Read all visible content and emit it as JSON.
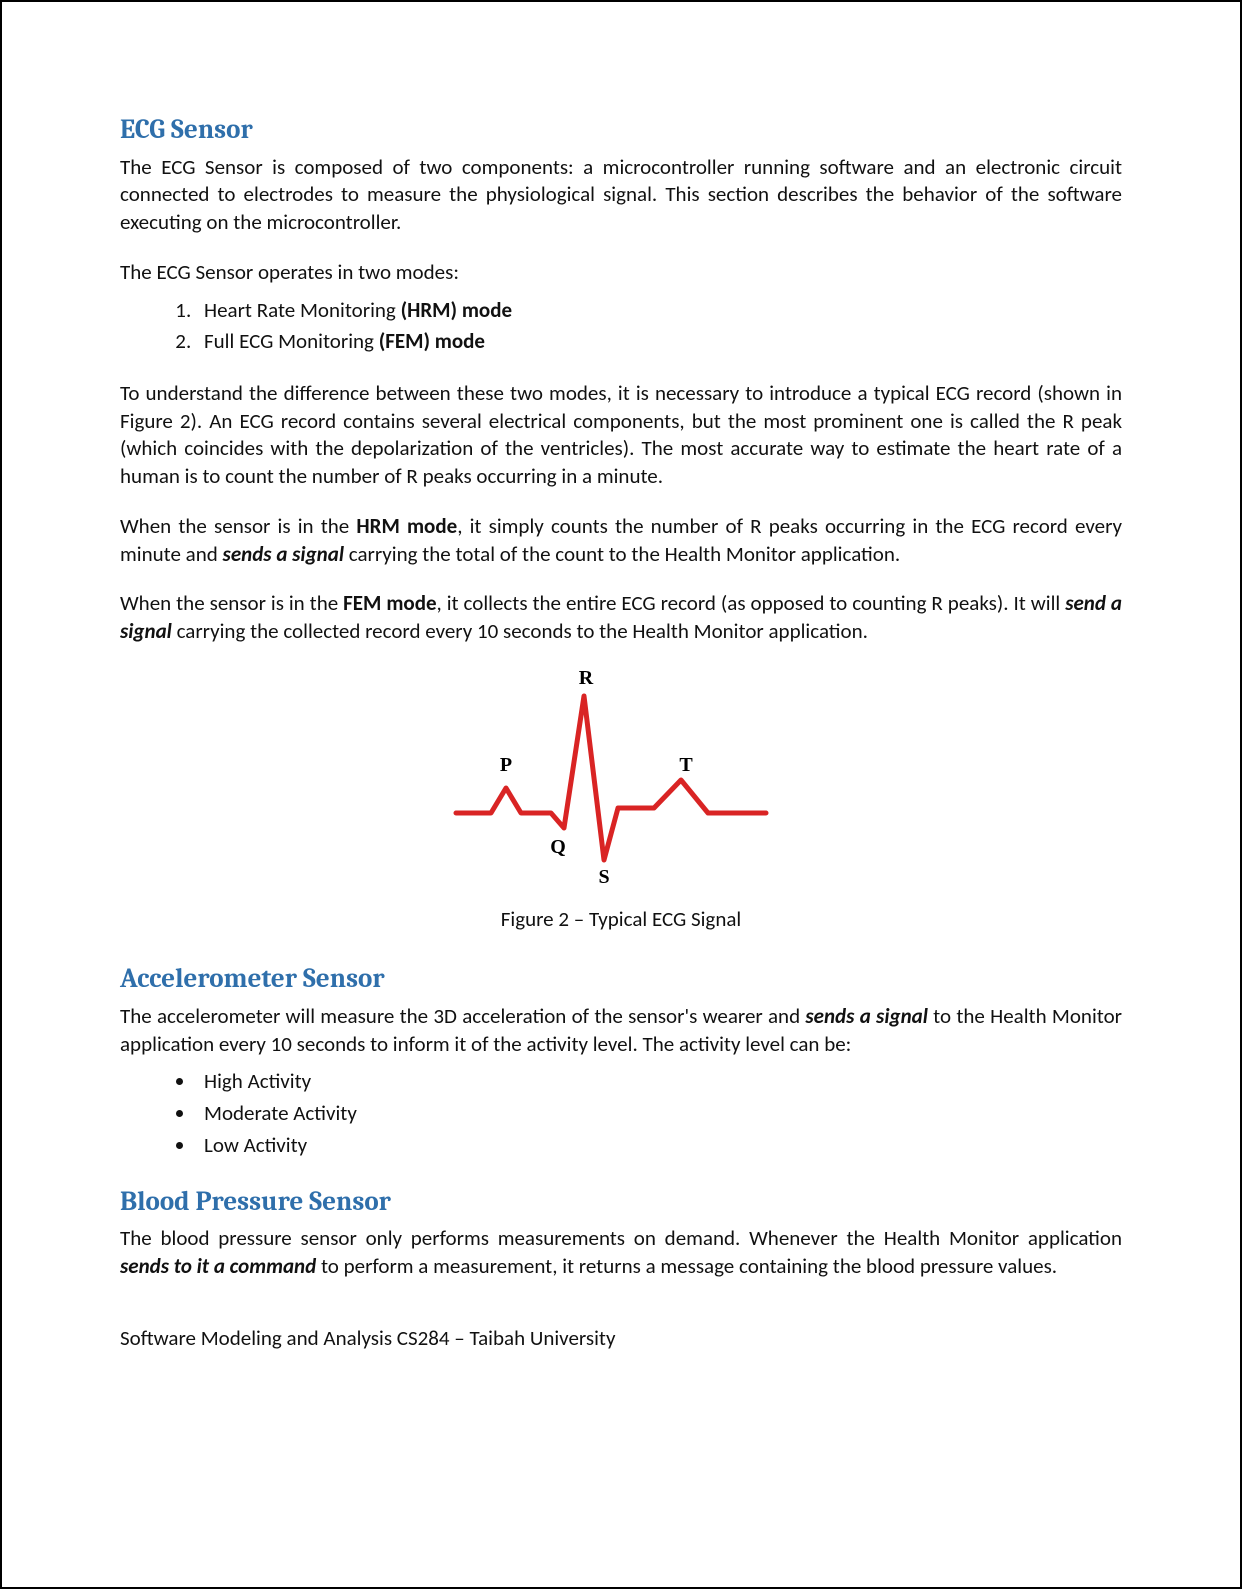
{
  "sections": {
    "ecg": {
      "title": "ECG Sensor",
      "p1": "The ECG Sensor is composed of two components: a microcontroller running software and an electronic circuit connected to electrodes to measure the physiological signal. This section describes the behavior of the software executing on the microcontroller.",
      "p2": "The ECG Sensor operates in two modes:",
      "modes": {
        "m1_pre": "Heart Rate Monitoring ",
        "m1_bold": "(HRM) mode",
        "m2_pre": "Full ECG Monitoring ",
        "m2_bold": "(FEM) mode"
      },
      "p3": "To understand the difference between these two modes, it is necessary to introduce a typical ECG record (shown in Figure 2). An ECG record contains several electrical components, but the most prominent one is called the R peak (which coincides with the depolarization of the ventricles). The most accurate way to estimate the heart rate of a human is to count the number of R peaks occurring in a minute.",
      "p4": {
        "a": "When the sensor is in the ",
        "b": "HRM mode",
        "c": ", it simply counts the number of R peaks occurring in the ECG record every minute and ",
        "d": "sends a signal",
        "e": " carrying the total of the count to the Health Monitor application."
      },
      "p5": {
        "a": "When the sensor is in the ",
        "b": "FEM mode",
        "c": ", it collects the entire ECG record (as opposed to counting R peaks). It will ",
        "d": "send a signal",
        "e": " carrying the collected record every 10 seconds to the Health Monitor application."
      }
    },
    "figure": {
      "labels": {
        "R": "R",
        "P": "P",
        "T": "T",
        "Q": "Q",
        "S": "S"
      },
      "caption": "Figure 2 – Typical ECG Signal"
    },
    "accel": {
      "title": "Accelerometer Sensor",
      "p1": {
        "a": "The accelerometer will measure the 3D acceleration of the sensor's wearer and ",
        "b": "sends a signal",
        "c": " to the Health Monitor application every 10 seconds to inform it of the activity level. The activity level can be:"
      },
      "levels": [
        "High Activity",
        "Moderate Activity",
        "Low Activity"
      ]
    },
    "bp": {
      "title": "Blood Pressure Sensor",
      "p1": {
        "a": "The blood pressure sensor only performs measurements on demand. Whenever the Health Monitor application ",
        "b": "sends to it a command",
        "c": " to perform a measurement, it returns a message containing the blood pressure values."
      }
    }
  },
  "footer": "Software Modeling and Analysis CS284 – Taibah University"
}
